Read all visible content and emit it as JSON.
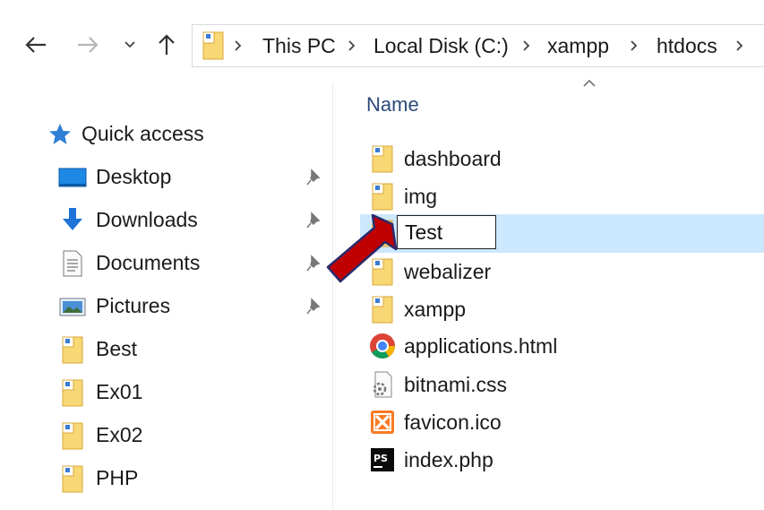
{
  "toolbar": {
    "back_icon": "arrow-left-icon",
    "forward_icon": "arrow-right-icon",
    "recent_icon": "chevron-down-icon",
    "up_icon": "arrow-up-icon"
  },
  "address": {
    "crumbs": [
      "This PC",
      "Local Disk (C:)",
      "xampp",
      "htdocs"
    ]
  },
  "sidebar": {
    "quick_access": "Quick access",
    "items": [
      {
        "label": "Desktop",
        "icon": "desktop-icon",
        "pinned": true
      },
      {
        "label": "Downloads",
        "icon": "download-icon",
        "pinned": true
      },
      {
        "label": "Documents",
        "icon": "document-icon",
        "pinned": true
      },
      {
        "label": "Pictures",
        "icon": "pictures-icon",
        "pinned": true
      },
      {
        "label": "Best",
        "icon": "folder-icon",
        "pinned": false
      },
      {
        "label": "Ex01",
        "icon": "folder-icon",
        "pinned": false
      },
      {
        "label": "Ex02",
        "icon": "folder-icon",
        "pinned": false
      },
      {
        "label": "PHP",
        "icon": "folder-icon",
        "pinned": false
      }
    ]
  },
  "filelist": {
    "column_name": "Name",
    "files": [
      {
        "name": "dashboard",
        "icon": "folder-icon"
      },
      {
        "name": "img",
        "icon": "folder-icon"
      },
      {
        "name": "Test",
        "icon": "folder-icon",
        "selected": true,
        "renaming": true
      },
      {
        "name": "webalizer",
        "icon": "folder-icon"
      },
      {
        "name": "xampp",
        "icon": "folder-icon"
      },
      {
        "name": "applications.html",
        "icon": "chrome-icon"
      },
      {
        "name": "bitnami.css",
        "icon": "css-file-icon"
      },
      {
        "name": "favicon.ico",
        "icon": "xampp-icon"
      },
      {
        "name": "index.php",
        "icon": "phpstorm-icon"
      }
    ]
  },
  "colors": {
    "selection": "#cce8ff",
    "folder": "#f8d775",
    "header_text": "#2c4a7a",
    "arrow": "#c00000"
  }
}
